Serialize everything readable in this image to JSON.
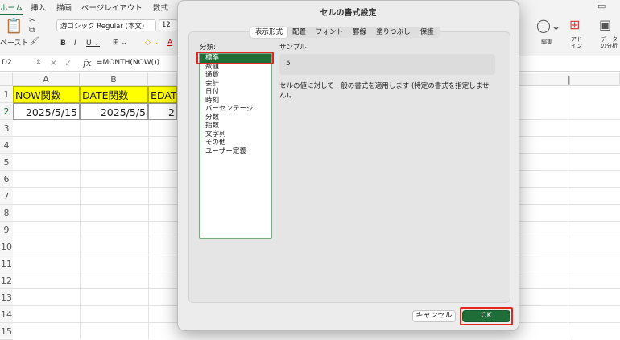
{
  "ribbon": {
    "tabs": [
      "ホーム",
      "挿入",
      "描画",
      "ページレイアウト",
      "数式"
    ],
    "paste_label": "ペースト",
    "font_name": "游ゴシック Regular (本文)",
    "font_size": "12",
    "edit_label": "編集",
    "addin_label": "アド\nイン",
    "data_label": "データ\nの分析"
  },
  "formula_bar": {
    "cell_ref": "D2",
    "formula": "=MONTH(NOW())"
  },
  "grid": {
    "columns": [
      "A",
      "B"
    ],
    "rows": [
      "1",
      "2",
      "3",
      "4",
      "5",
      "6",
      "7",
      "8",
      "9",
      "10",
      "11",
      "12",
      "13",
      "14",
      "15"
    ],
    "cells": {
      "a1": "NOW関数",
      "b1": "DATE関数",
      "c1": "EDAT",
      "a2": "2025/5/15",
      "b2": "2025/5/5",
      "c2": "2"
    }
  },
  "dialog": {
    "title": "セルの書式設定",
    "tabs": [
      "表示形式",
      "配置",
      "フォント",
      "罫線",
      "塗りつぶし",
      "保護"
    ],
    "category_label": "分類:",
    "categories": [
      "標準",
      "数値",
      "通貨",
      "会計",
      "日付",
      "時刻",
      "パーセンテージ",
      "分数",
      "指数",
      "文字列",
      "その他",
      "ユーザー定義"
    ],
    "selected_category": "標準",
    "sample_label": "サンプル",
    "sample_value": "5",
    "description": "セルの値に対して一般の書式を適用します (特定の書式を指定しません)。",
    "cancel_label": "キャンセル",
    "ok_label": "OK"
  },
  "colors": {
    "accent": "#1f6e3a",
    "highlight": "#e2271c",
    "header_fill": "#ffff00"
  }
}
